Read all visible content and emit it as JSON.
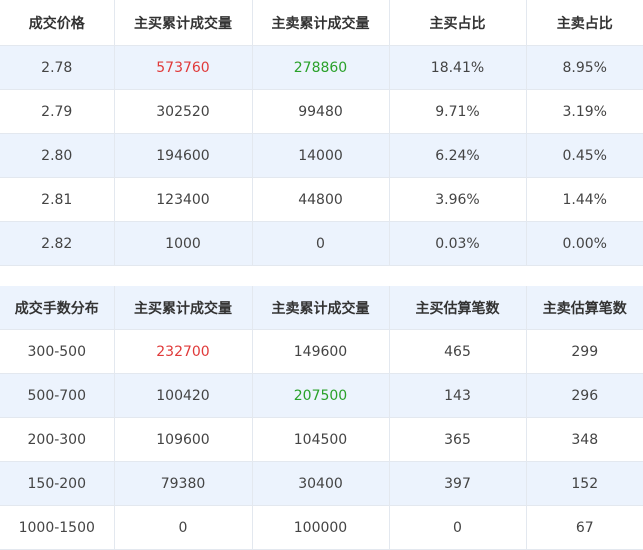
{
  "price_table": {
    "headers": [
      "成交价格",
      "主买累计成交量",
      "主卖累计成交量",
      "主买占比",
      "主卖占比"
    ],
    "rows": [
      [
        "2.78",
        "573760",
        "278860",
        "18.41%",
        "8.95%"
      ],
      [
        "2.79",
        "302520",
        "99480",
        "9.71%",
        "3.19%"
      ],
      [
        "2.80",
        "194600",
        "14000",
        "6.24%",
        "0.45%"
      ],
      [
        "2.81",
        "123400",
        "44800",
        "3.96%",
        "1.44%"
      ],
      [
        "2.82",
        "1000",
        "0",
        "0.03%",
        "0.00%"
      ]
    ]
  },
  "lot_table": {
    "headers": [
      "成交手数分布",
      "主买累计成交量",
      "主卖累计成交量",
      "主买估算笔数",
      "主卖估算笔数"
    ],
    "rows": [
      [
        "300-500",
        "232700",
        "149600",
        "465",
        "299"
      ],
      [
        "500-700",
        "100420",
        "207500",
        "143",
        "296"
      ],
      [
        "200-300",
        "109600",
        "104500",
        "365",
        "348"
      ],
      [
        "150-200",
        "79380",
        "30400",
        "397",
        "152"
      ],
      [
        "1000-1500",
        "0",
        "100000",
        "0",
        "67"
      ]
    ]
  },
  "colors": {
    "highlight_red": "#e03a3a",
    "highlight_green": "#2aa12a",
    "row_tint": "#ecf3fd"
  }
}
